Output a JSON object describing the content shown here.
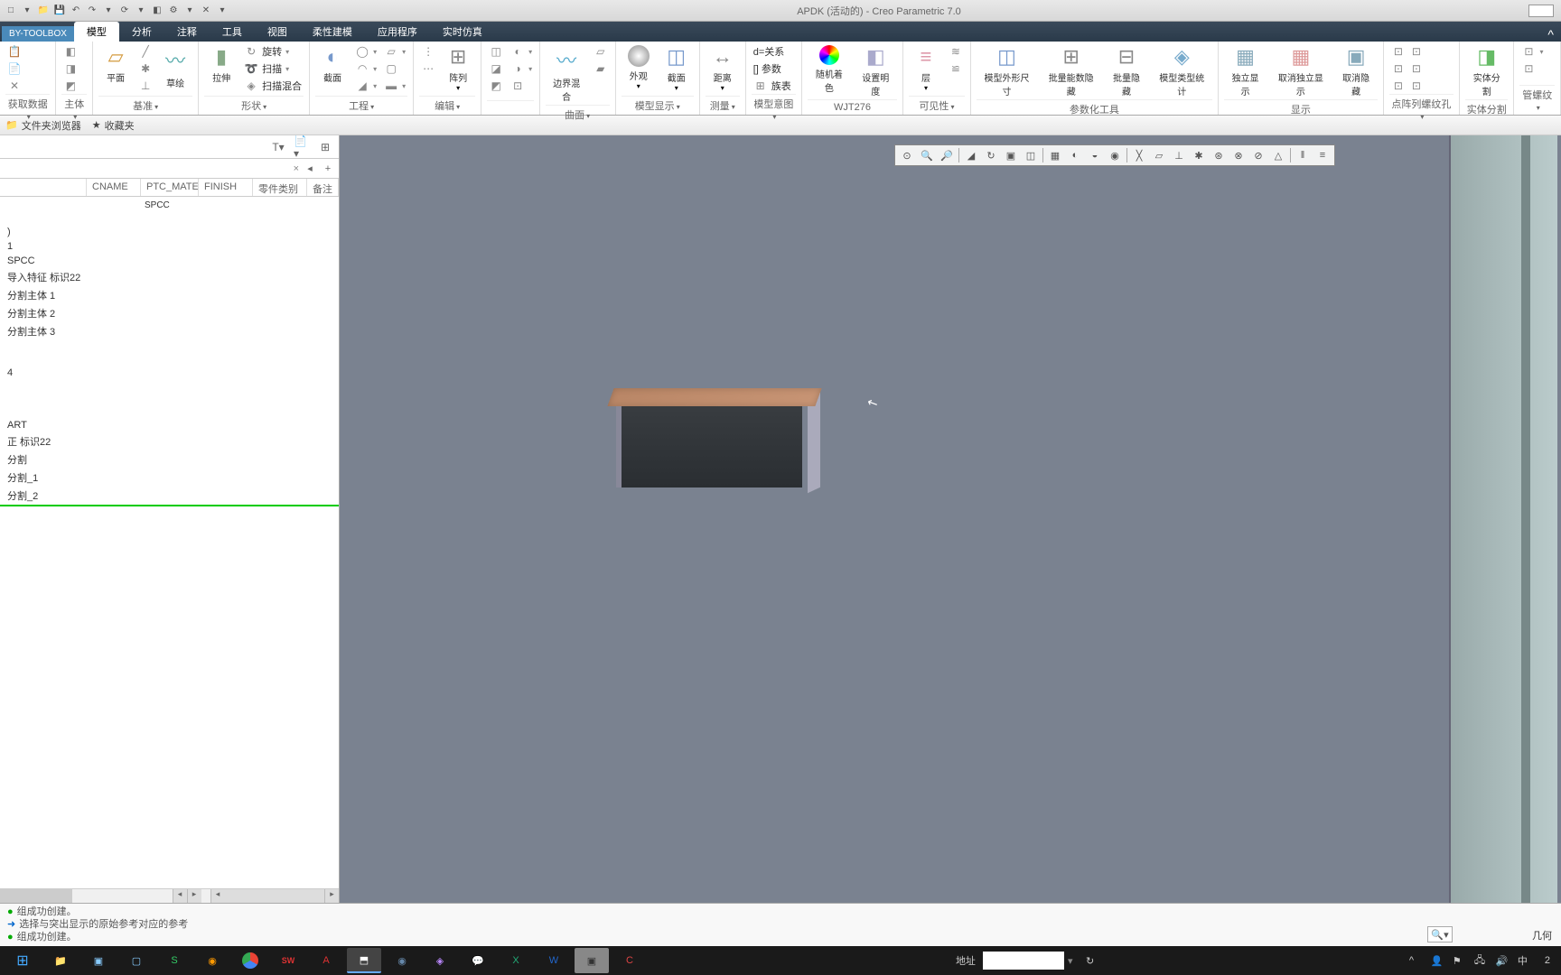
{
  "app": {
    "title": "APDK (活动的) - Creo Parametric 7.0"
  },
  "ribbon": {
    "toolbox": "BY-TOOLBOX",
    "tabs": [
      "模型",
      "分析",
      "注释",
      "工具",
      "视图",
      "柔性建模",
      "应用程序",
      "实时仿真"
    ],
    "active": "模型",
    "groups": {
      "getdata": {
        "label": "获取数据",
        "items": [
          "复制",
          "粘贴"
        ]
      },
      "body": {
        "label": "主体"
      },
      "datum": {
        "label": "基准",
        "plane": "平面",
        "sketch": "草绘"
      },
      "shape": {
        "label": "形状",
        "extrude": "拉伸",
        "revolve": "旋转",
        "sweep": "扫描",
        "sweepblend": "扫描混合"
      },
      "engineering": {
        "label": "工程",
        "profile": "截面"
      },
      "pattern": {
        "label": "阵列"
      },
      "edit": {
        "label": "编辑"
      },
      "surface": {
        "label": "曲面",
        "boundary": "边界混合"
      },
      "modeldisp": {
        "label": "模型显示",
        "apprnc": "外观",
        "section": "截面"
      },
      "measure": {
        "label": "测量",
        "distance": "距离"
      },
      "modelintent": {
        "label": "模型意图",
        "relation": "d=关系",
        "param": "[] 参数",
        "family": "族表"
      },
      "wjt": {
        "label": "WJT276",
        "random": "随机着色",
        "transp": "设置明度"
      },
      "visibility": {
        "label": "可见性",
        "layer": "层"
      },
      "paramtools": {
        "label": "参数化工具",
        "modelsize": "模型外形尺寸",
        "batchhide": "批量能数隐藏",
        "batchsupp": "批量隐藏",
        "modelstat": "模型类型统计"
      },
      "display": {
        "label": "显示",
        "indep": "独立显示",
        "cancel": "取消独立显示",
        "hide": "取消隐藏"
      },
      "pointarray": {
        "label": "点阵列螺纹孔"
      },
      "bodysplit": {
        "label": "实体分割",
        "split": "实体分割"
      },
      "reserved": {
        "label": "管螺纹"
      }
    }
  },
  "secondary": {
    "folder": "文件夹浏览器",
    "favorites": "收藏夹"
  },
  "navigator": {
    "columns": {
      "cname": "CNAME",
      "material": "PTC_MATERIAL",
      "finish": "FINISH",
      "parttype": "零件类别",
      "note": "备注"
    },
    "spcc": "SPCC",
    "items": [
      ")",
      "1",
      "SPCC",
      "导入特征 标识22",
      "分割主体 1",
      "分割主体 2",
      "分割主体 3",
      "",
      "",
      "4",
      "",
      "ART",
      "正 标识22",
      "分割",
      "分割_1",
      "分割_2"
    ]
  },
  "messages": [
    "组成功创建。",
    "选择与突出显示的原始参考对应的参考",
    "组成功创建。"
  ],
  "statusbar": {
    "geom": "几何"
  },
  "taskbar": {
    "addr_label": "地址",
    "lang": "中",
    "time": "2"
  }
}
